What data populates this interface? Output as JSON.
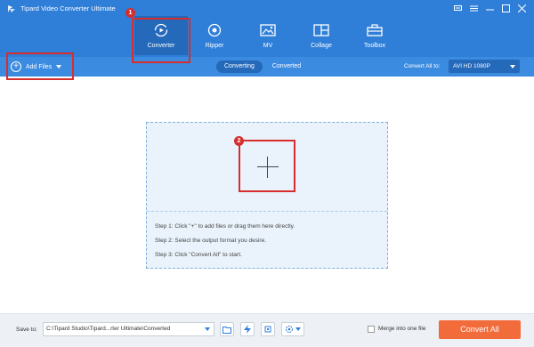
{
  "app": {
    "title": "Tipard Video Converter Ultimate"
  },
  "window_controls": [
    {
      "name": "feedback-icon",
      "glyph": "▭"
    },
    {
      "name": "menu-icon",
      "glyph": "≡"
    },
    {
      "name": "minimize-icon",
      "glyph": "—"
    },
    {
      "name": "maximize-icon",
      "glyph": "☐"
    },
    {
      "name": "close-icon",
      "glyph": "✕"
    }
  ],
  "nav": {
    "items": [
      {
        "label": "Converter",
        "icon": "converter-icon",
        "active": true
      },
      {
        "label": "Ripper",
        "icon": "ripper-icon",
        "active": false
      },
      {
        "label": "MV",
        "icon": "mv-icon",
        "active": false
      },
      {
        "label": "Collage",
        "icon": "collage-icon",
        "active": false
      },
      {
        "label": "Toolbox",
        "icon": "toolbox-icon",
        "active": false
      }
    ]
  },
  "toolbar": {
    "add_files_label": "Add Files",
    "tabs": [
      {
        "label": "Converting",
        "active": true
      },
      {
        "label": "Converted",
        "active": false
      }
    ],
    "convert_all_to_label": "Convert All to:",
    "format_value": "AVI HD 1080P"
  },
  "dropzone": {
    "steps": [
      "Step 1: Click \"+\" to add files or drag them here directly.",
      "Step 2: Select the output format you desire.",
      "Step 3: Click \"Convert All\" to start."
    ]
  },
  "annotations": [
    {
      "number": "1"
    },
    {
      "number": "2"
    }
  ],
  "bottom": {
    "save_to_label": "Save to:",
    "save_path": "C:\\Tipard Studio\\Tipard...rter Ultimate\\Converted",
    "merge_label": "Merge into one file",
    "convert_all_label": "Convert All"
  },
  "colors": {
    "primary": "#2f7ed8",
    "primary_dark": "#2469ba",
    "accent_orange": "#f26b3a",
    "annotation_red": "#d62e2e",
    "dropzone_bg": "#eaf3fc"
  }
}
